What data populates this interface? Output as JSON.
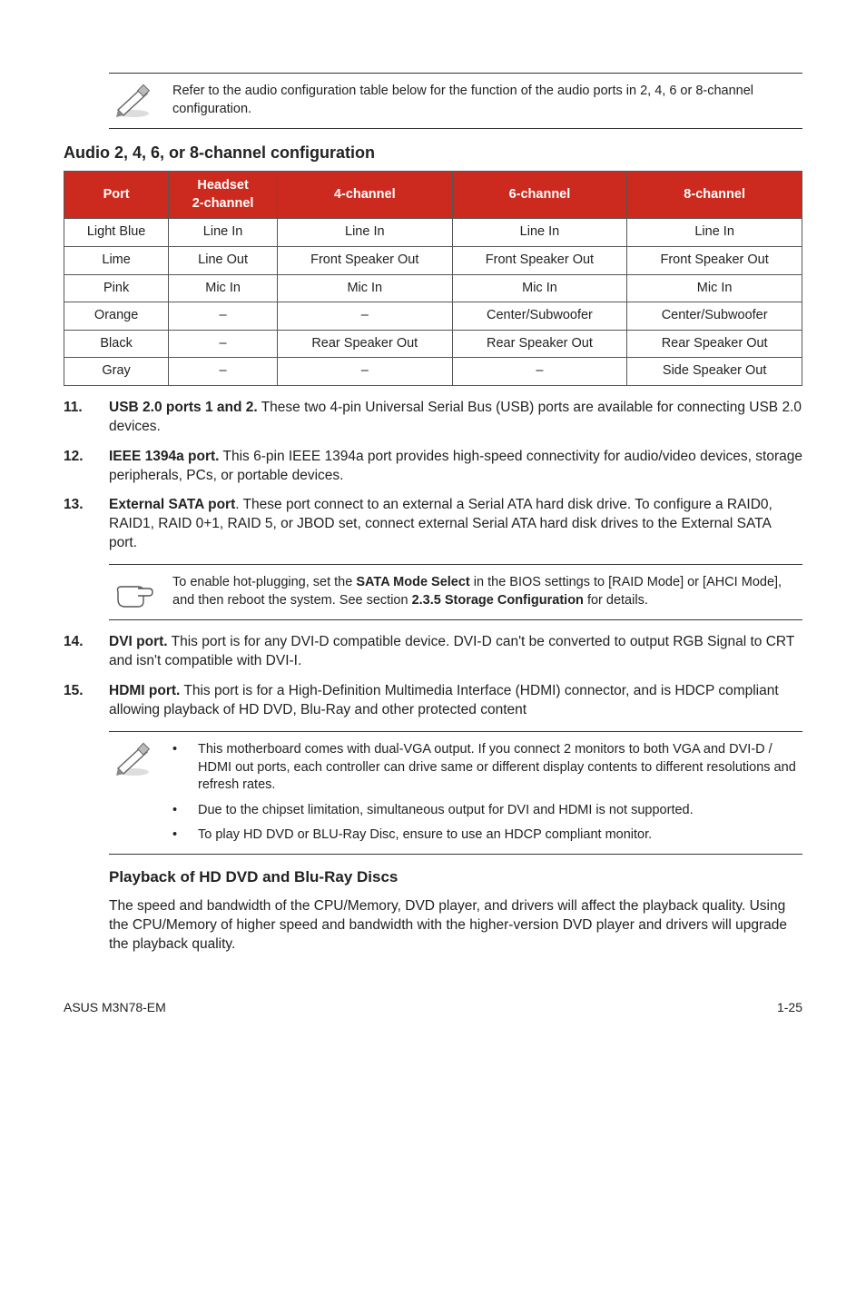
{
  "noteTop": "Refer to the audio configuration table below for the function of the audio ports in 2, 4, 6 or 8-channel configuration.",
  "audioHeading": "Audio 2, 4, 6, or 8-channel configuration",
  "table": {
    "headers": [
      "Port",
      "Headset\n2-channel",
      "4-channel",
      "6-channel",
      "8-channel"
    ],
    "rows": [
      [
        "Light Blue",
        "Line In",
        "Line In",
        "Line In",
        "Line In"
      ],
      [
        "Lime",
        "Line Out",
        "Front Speaker Out",
        "Front Speaker Out",
        "Front Speaker Out"
      ],
      [
        "Pink",
        "Mic In",
        "Mic In",
        "Mic In",
        "Mic In"
      ],
      [
        "Orange",
        "–",
        "–",
        "Center/Subwoofer",
        "Center/Subwoofer"
      ],
      [
        "Black",
        "–",
        "Rear Speaker Out",
        "Rear Speaker Out",
        "Rear Speaker Out"
      ],
      [
        "Gray",
        "–",
        "–",
        "–",
        "Side Speaker Out"
      ]
    ]
  },
  "items": {
    "11": {
      "num": "11.",
      "boldLead": "USB 2.0 ports 1 and 2.",
      "rest": " These two 4-pin Universal Serial Bus (USB) ports are available for connecting USB 2.0 devices."
    },
    "12": {
      "num": "12.",
      "boldLead": "IEEE 1394a port.",
      "rest": " This 6-pin IEEE 1394a port provides high-speed connectivity for audio/video devices, storage peripherals, PCs, or portable devices."
    },
    "13": {
      "num": "13.",
      "boldLead": "External SATA port",
      "rest": ". These port connect to an external a Serial ATA hard disk drive. To configure a RAID0, RAID1, RAID 0+1, RAID 5, or JBOD set, connect external Serial ATA hard disk drives to the External SATA port."
    },
    "14": {
      "num": "14.",
      "boldLead": "DVI port.",
      "rest": " This port is for any DVI-D compatible device. DVI-D can't be converted to output RGB  Signal to CRT and isn't compatible with DVI-I."
    },
    "15": {
      "num": "15.",
      "boldLead": "HDMI port.",
      "rest": " This port is for a High-Definition Multimedia Interface (HDMI) connector, and is HDCP compliant allowing playback of HD DVD, Blu-Ray and other protected content"
    }
  },
  "noteSata": {
    "pre": "To enable hot-plugging, set the ",
    "bold1": "SATA Mode Select",
    "mid": " in the BIOS settings to [RAID Mode] or [AHCI Mode], and then reboot the system. See section ",
    "bold2": "2.3.5 Storage Configuration",
    "post": " for details."
  },
  "noteVga": {
    "b1": "This motherboard comes with dual-VGA output. If you connect 2 monitors to both VGA and DVI-D / HDMI out ports, each controller can drive same or different display contents to different resolutions and refresh rates.",
    "b2": "Due to the chipset limitation, simultaneous output for DVI and HDMI is not supported.",
    "b3": "To play HD DVD or BLU-Ray Disc, ensure to use an HDCP compliant monitor."
  },
  "playbackHeading": "Playback of HD DVD and Blu-Ray Discs",
  "playbackBody": "The speed and bandwidth of the CPU/Memory, DVD player, and drivers will affect the playback quality. Using the CPU/Memory of higher speed and bandwidth with the higher-version DVD player and drivers will upgrade the playback quality.",
  "footerLeft": "ASUS M3N78-EM",
  "footerRight": "1-25"
}
